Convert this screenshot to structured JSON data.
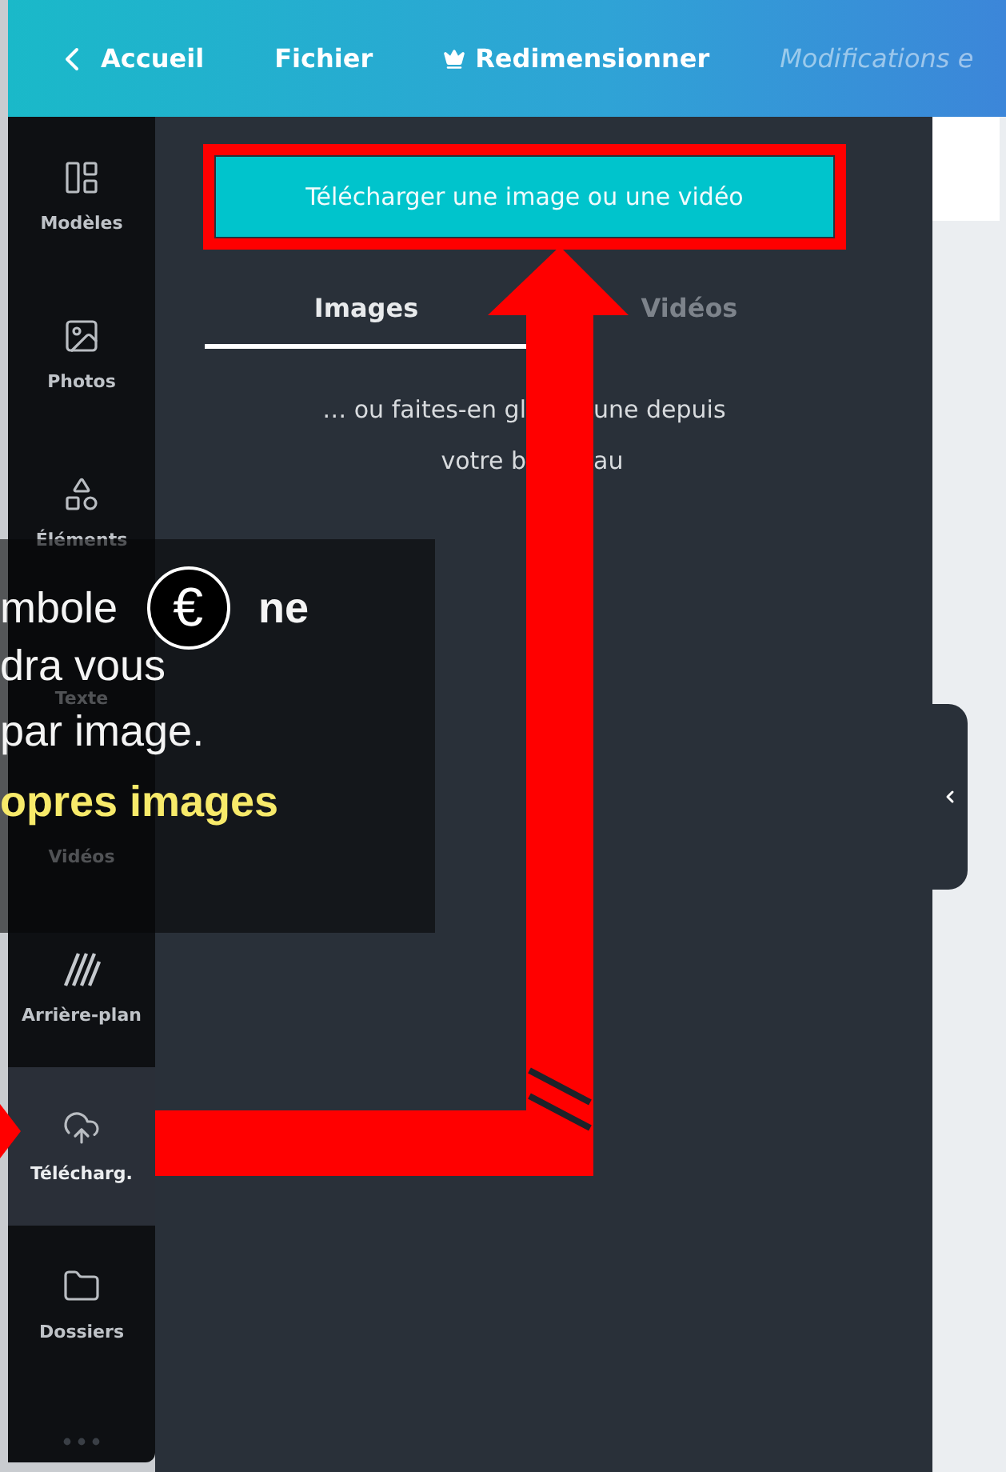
{
  "topbar": {
    "items": [
      {
        "label": "Accueil",
        "kind": "back"
      },
      {
        "label": "Fichier",
        "kind": "plain"
      },
      {
        "label": "Redimensionner",
        "kind": "crown"
      },
      {
        "label": "Modifications e",
        "kind": "status"
      }
    ]
  },
  "sidebar": {
    "items": [
      {
        "label": "Modèles",
        "selected": false
      },
      {
        "label": "Photos",
        "selected": false
      },
      {
        "label": "Éléments",
        "selected": false
      },
      {
        "label": "Texte",
        "selected": false
      },
      {
        "label": "Vidéos",
        "selected": false
      },
      {
        "label": "Arrière-plan",
        "selected": false
      },
      {
        "label": "Télécharg.",
        "selected": true
      },
      {
        "label": "Dossiers",
        "selected": false
      }
    ]
  },
  "panel": {
    "upload_button": "Télécharger une image ou une vidéo",
    "tabs": [
      {
        "label": "Images",
        "selected": true
      },
      {
        "label": "Vidéos",
        "selected": false
      }
    ],
    "hint_lines": [
      {
        "left": "… ou faites-en gl",
        "right": "une depuis"
      },
      {
        "left": "votre b",
        "right": "au"
      }
    ]
  },
  "caption": {
    "lines": [
      {
        "kind": "icon_line",
        "before": "mbole",
        "icon": "€",
        "after": "ne"
      },
      {
        "kind": "plain",
        "text": "dra vous"
      },
      {
        "kind": "plain",
        "text": "par image."
      },
      {
        "kind": "highlight",
        "text": "opres images"
      }
    ]
  }
}
